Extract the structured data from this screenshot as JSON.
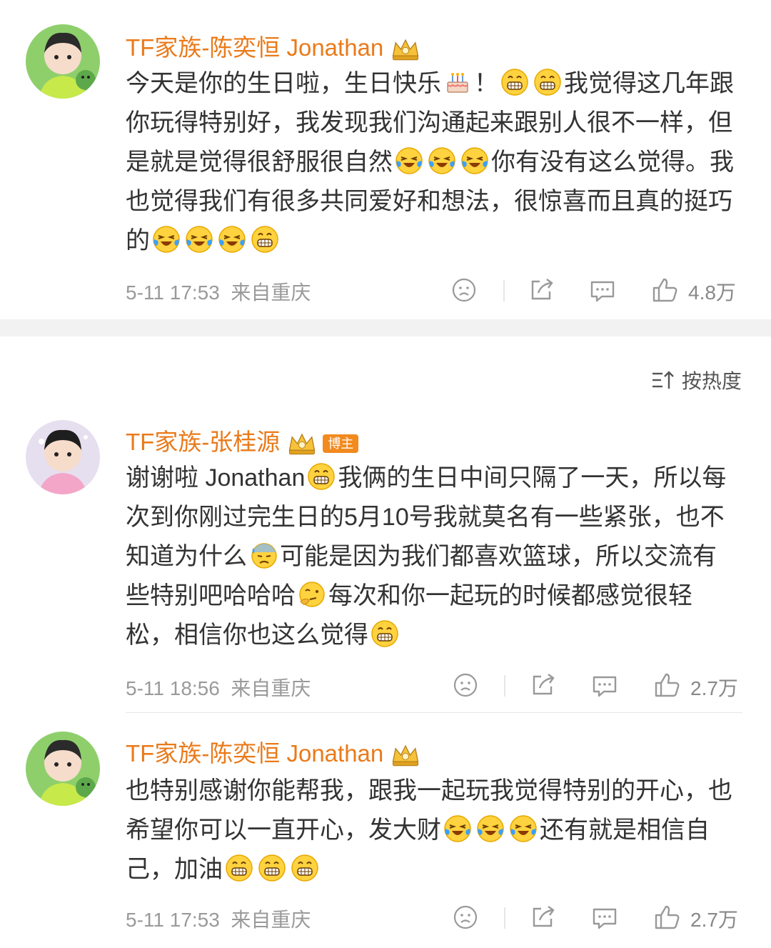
{
  "posts": [
    {
      "username": "TF家族-陈奕恒 Jonathan",
      "text_parts": [
        "今天是你的生日啦，生日快乐",
        "！",
        "我觉得这几年跟你玩得特别好，我发现我们沟通起来跟别人很不一样，但是就是觉得很舒服很自然",
        "你有没有这么觉得。我也觉得我们有很多共同爱好和想法，很惊喜而且真的挺巧的"
      ],
      "time": "5-11 17:53",
      "location": "来自重庆",
      "likes": "4.8万"
    },
    {
      "username": "TF家族-张桂源",
      "badge": "博主",
      "text_parts": [
        "谢谢啦 Jonathan",
        "我俩的生日中间只隔了一天，所以每次到你刚过完生日的5月10号我就莫名有一些紧张，也不知道为什么",
        "可能是因为我们都喜欢篮球，所以交流有些特别吧哈哈哈",
        "每次和你一起玩的时候都感觉很轻松，相信你也这么觉得"
      ],
      "time": "5-11 18:56",
      "location": "来自重庆",
      "likes": "2.7万"
    },
    {
      "username": "TF家族-陈奕恒 Jonathan",
      "text_parts": [
        "也特别感谢你能帮我，跟我一起玩我觉得特别的开心，也希望你可以一直开心，发大财",
        "还有就是相信自己，加油"
      ],
      "time": "5-11 17:53",
      "location": "来自重庆",
      "likes": "2.7万"
    }
  ],
  "sort_label": "按热度",
  "colors": {
    "username": "#ea7a1a",
    "meta": "#9a9a9a",
    "divider": "#f2f2f2"
  },
  "icons": [
    "crown-icon",
    "grin-emoji",
    "laugh-cry-emoji",
    "cake-emoji",
    "sweat-emoji",
    "thinking-emoji",
    "dislike-icon",
    "share-icon",
    "comment-icon",
    "like-icon",
    "sort-icon"
  ]
}
